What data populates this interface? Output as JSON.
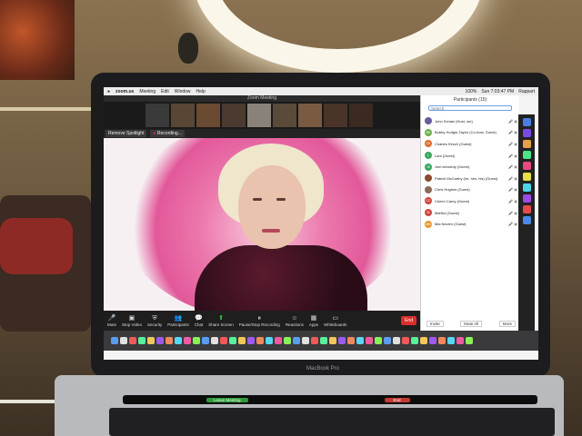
{
  "menubar": {
    "app_name": "zoom.us",
    "items": [
      "Meeting",
      "Edit",
      "Window",
      "Help"
    ],
    "status_text": "100%",
    "datetime": "Sun 7:03:47 PM",
    "user_name": "Rappart"
  },
  "zoom_window": {
    "title": "Zoom Meeting",
    "spotlight_button": "Remove Spotlight",
    "recording_label": "Recording..."
  },
  "controls": [
    {
      "icon": "mic-icon",
      "label": "Mute"
    },
    {
      "icon": "video-icon",
      "label": "Stop Video"
    },
    {
      "icon": "shield-icon",
      "label": "Security"
    },
    {
      "icon": "people-icon",
      "label": "Participants"
    },
    {
      "icon": "chat-icon",
      "label": "Chat"
    },
    {
      "icon": "share-icon",
      "label": "Share Screen"
    },
    {
      "icon": "record-icon",
      "label": "Pause/Stop Recording"
    },
    {
      "icon": "smile-icon",
      "label": "Reactions"
    },
    {
      "icon": "apps-icon",
      "label": "Apps"
    },
    {
      "icon": "board-icon",
      "label": "Whiteboards"
    }
  ],
  "end_button": "End",
  "participants": {
    "title": "Participants (15)",
    "search_placeholder": "Search",
    "list": [
      {
        "name": "John Schatz (Host, me)",
        "initials": "",
        "color": "#6b5a9e"
      },
      {
        "name": "Bobby Hodgin-Taylor (Co-host, Guest)",
        "initials": "BH",
        "color": "#6ab04c"
      },
      {
        "name": "Charles Kirsch (Guest)",
        "initials": "CK",
        "color": "#e06b2c"
      },
      {
        "name": "Lani (Guest)",
        "initials": "L",
        "color": "#3aa860"
      },
      {
        "name": "Joel kennedy (Guest)",
        "initials": "JK",
        "color": "#3aa860"
      },
      {
        "name": "Patrick McCarthy (he, him, his) (Guest)",
        "initials": "",
        "color": "#8a4a30"
      },
      {
        "name": "Chris Hughes (Guest)",
        "initials": "",
        "color": "#8c6a5a"
      },
      {
        "name": "Cheen Carey (Guest)",
        "initials": "CC",
        "color": "#d0463c"
      },
      {
        "name": "Martha (Guest)",
        "initials": "M",
        "color": "#d0463c"
      },
      {
        "name": "Mia Nevien (Guest)",
        "initials": "MN",
        "color": "#e89a2c"
      }
    ],
    "footer": [
      "Invite",
      "Mute All",
      "More"
    ]
  },
  "brand": "MacBook Pro",
  "touchbar": {
    "green_label": "Leave Meeting",
    "red_label": "End"
  }
}
